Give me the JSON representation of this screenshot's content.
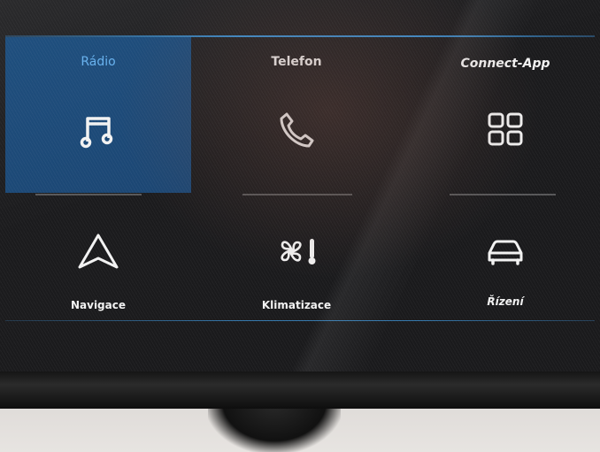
{
  "top_row": [
    {
      "label": "Rádio",
      "icon": "music-note-icon",
      "active": true
    },
    {
      "label": "Telefon",
      "icon": "phone-icon",
      "active": false
    },
    {
      "label": "Connect-App",
      "icon": "apps-grid-icon",
      "active": false
    }
  ],
  "bottom_row": [
    {
      "label": "Navigace",
      "icon": "navigation-arrow-icon"
    },
    {
      "label": "Klimatizace",
      "icon": "fan-thermometer-icon"
    },
    {
      "label": "Řízení",
      "icon": "car-icon"
    }
  ],
  "colors": {
    "accent": "#3b8fd0",
    "active_tile": "#1f4f7e",
    "active_label": "#67b1ee",
    "screen_bg": "#1b1b1d"
  }
}
